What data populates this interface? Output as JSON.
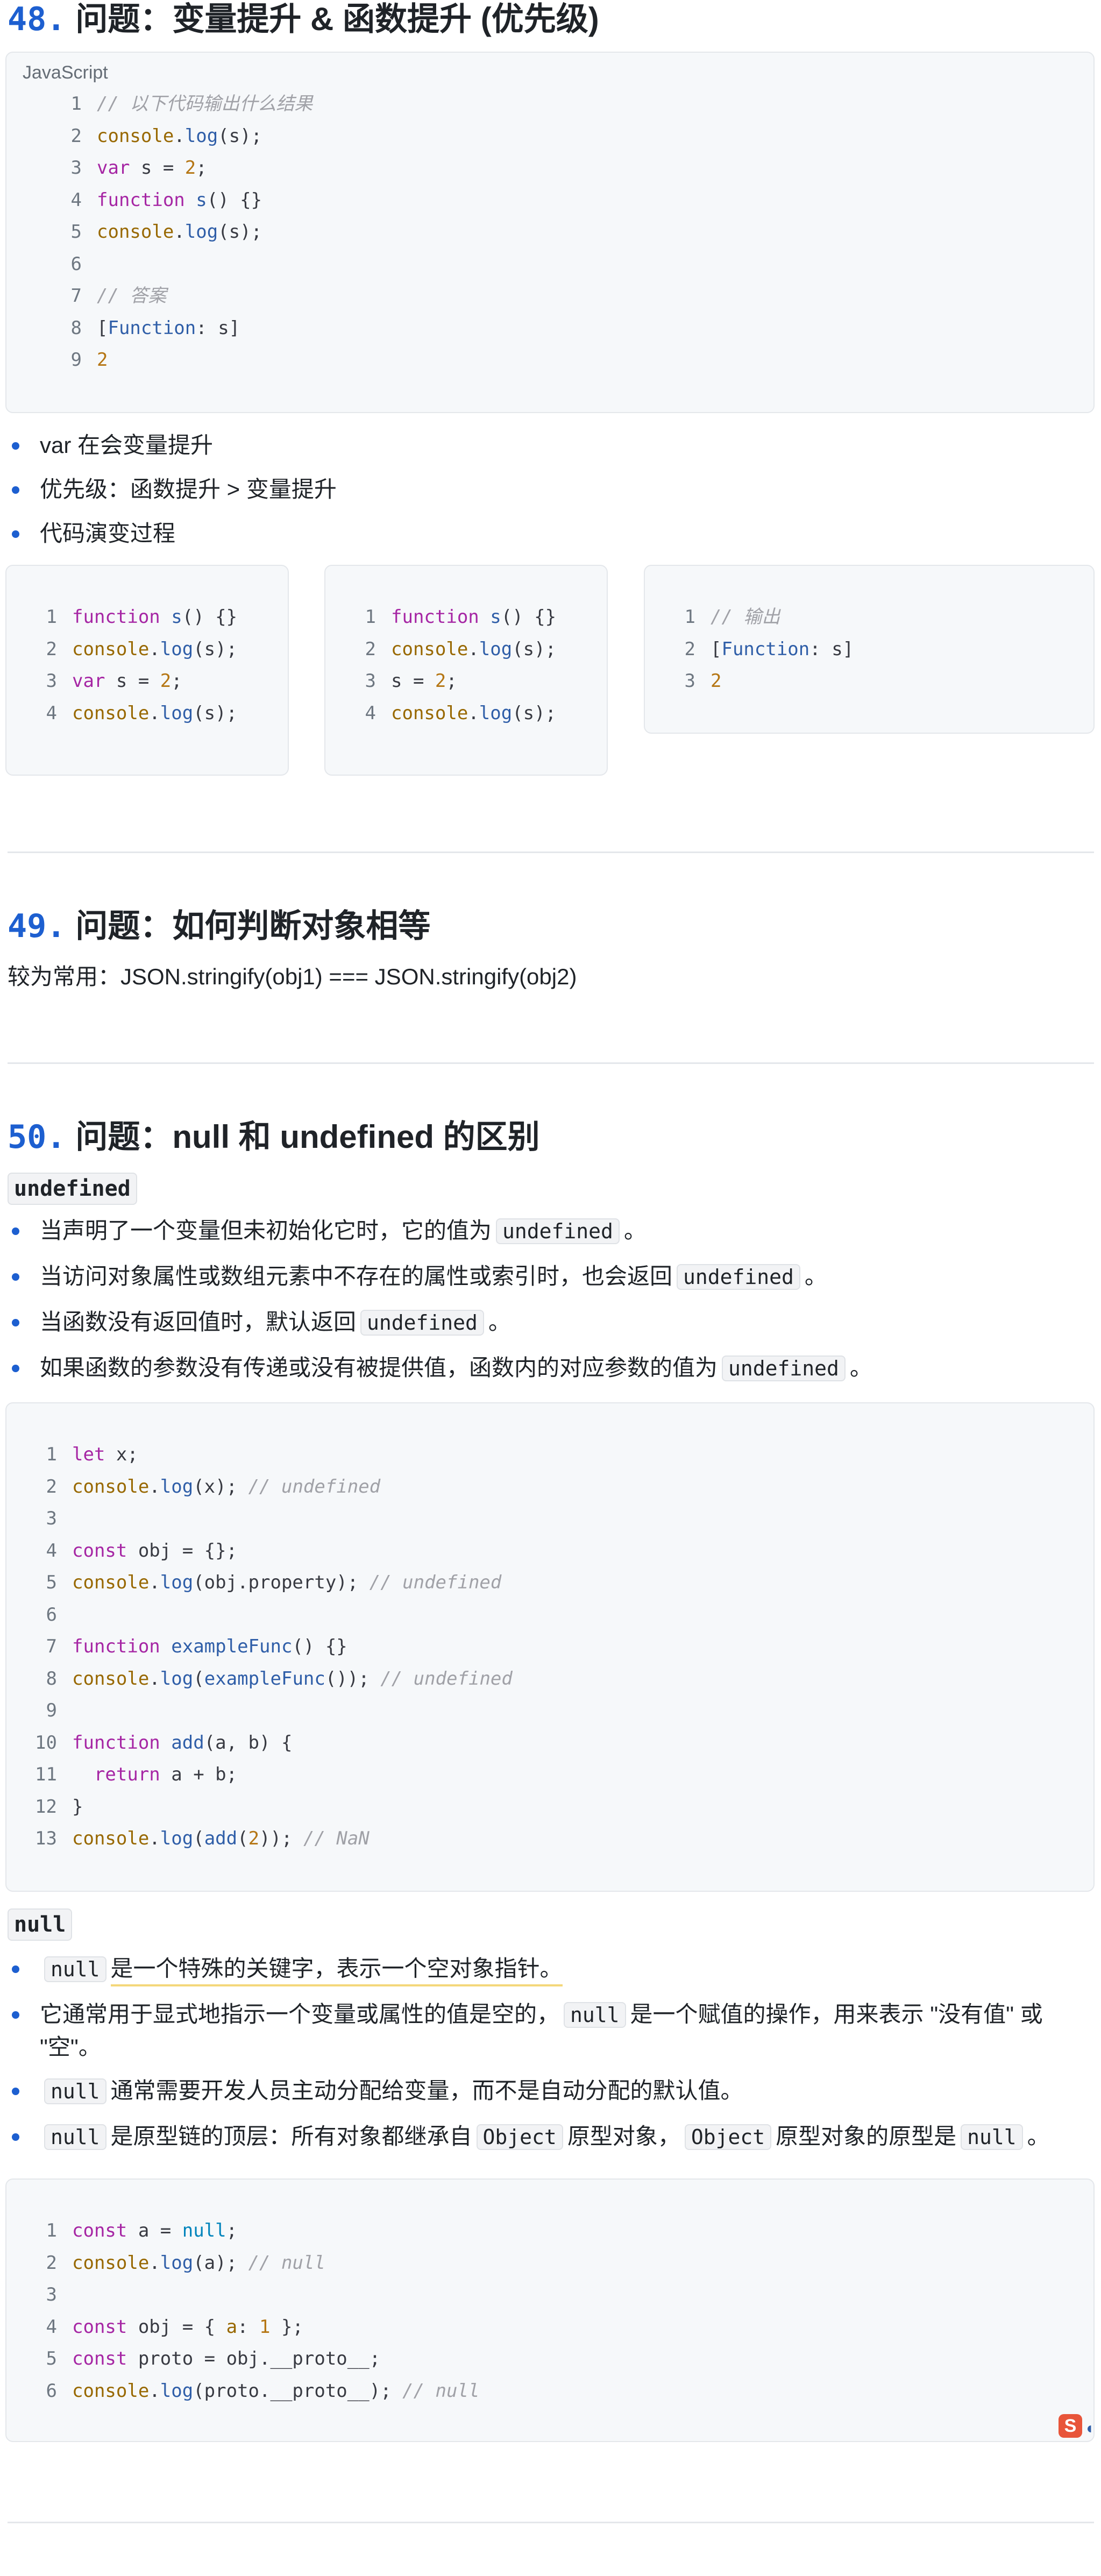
{
  "q48": {
    "num": "48.",
    "title": "问题：变量提升 & 函数提升 (优先级)",
    "lang": "JavaScript",
    "code": [
      {
        "n": "1",
        "parts": [
          {
            "c": "cm",
            "t": "// 以下代码输出什么结果"
          }
        ]
      },
      {
        "n": "2",
        "parts": [
          {
            "c": "obj",
            "t": "console"
          },
          {
            "c": "txt",
            "t": "."
          },
          {
            "c": "fn",
            "t": "log"
          },
          {
            "c": "txt",
            "t": "(s);"
          }
        ]
      },
      {
        "n": "3",
        "parts": [
          {
            "c": "kw",
            "t": "var"
          },
          {
            "c": "txt",
            "t": " s = "
          },
          {
            "c": "numv",
            "t": "2"
          },
          {
            "c": "txt",
            "t": ";"
          }
        ]
      },
      {
        "n": "4",
        "parts": [
          {
            "c": "kw",
            "t": "function"
          },
          {
            "c": "txt",
            "t": " "
          },
          {
            "c": "fn",
            "t": "s"
          },
          {
            "c": "txt",
            "t": "() {}"
          }
        ]
      },
      {
        "n": "5",
        "parts": [
          {
            "c": "obj",
            "t": "console"
          },
          {
            "c": "txt",
            "t": "."
          },
          {
            "c": "fn",
            "t": "log"
          },
          {
            "c": "txt",
            "t": "(s);"
          }
        ]
      },
      {
        "n": "6",
        "parts": []
      },
      {
        "n": "7",
        "parts": [
          {
            "c": "cm",
            "t": "// 答案"
          }
        ]
      },
      {
        "n": "8",
        "parts": [
          {
            "c": "txt",
            "t": "["
          },
          {
            "c": "fn",
            "t": "Function"
          },
          {
            "c": "txt",
            "t": ": s]"
          }
        ]
      },
      {
        "n": "9",
        "parts": [
          {
            "c": "numv",
            "t": "2"
          }
        ]
      }
    ],
    "bullets": [
      "var 在会变量提升",
      "优先级：函数提升 > 变量提升",
      "代码演变过程"
    ],
    "evolution": [
      [
        {
          "n": "1",
          "parts": [
            {
              "c": "kw",
              "t": "function"
            },
            {
              "c": "txt",
              "t": " "
            },
            {
              "c": "fn",
              "t": "s"
            },
            {
              "c": "txt",
              "t": "() {}"
            }
          ]
        },
        {
          "n": "2",
          "parts": [
            {
              "c": "obj",
              "t": "console"
            },
            {
              "c": "txt",
              "t": "."
            },
            {
              "c": "fn",
              "t": "log"
            },
            {
              "c": "txt",
              "t": "(s);"
            }
          ]
        },
        {
          "n": "3",
          "parts": [
            {
              "c": "kw",
              "t": "var"
            },
            {
              "c": "txt",
              "t": " s = "
            },
            {
              "c": "numv",
              "t": "2"
            },
            {
              "c": "txt",
              "t": ";"
            }
          ]
        },
        {
          "n": "4",
          "parts": [
            {
              "c": "obj",
              "t": "console"
            },
            {
              "c": "txt",
              "t": "."
            },
            {
              "c": "fn",
              "t": "log"
            },
            {
              "c": "txt",
              "t": "(s);"
            }
          ]
        }
      ],
      [
        {
          "n": "1",
          "parts": [
            {
              "c": "kw",
              "t": "function"
            },
            {
              "c": "txt",
              "t": " "
            },
            {
              "c": "fn",
              "t": "s"
            },
            {
              "c": "txt",
              "t": "() {}"
            }
          ]
        },
        {
          "n": "2",
          "parts": [
            {
              "c": "obj",
              "t": "console"
            },
            {
              "c": "txt",
              "t": "."
            },
            {
              "c": "fn",
              "t": "log"
            },
            {
              "c": "txt",
              "t": "(s);"
            }
          ]
        },
        {
          "n": "3",
          "parts": [
            {
              "c": "txt",
              "t": "s = "
            },
            {
              "c": "numv",
              "t": "2"
            },
            {
              "c": "txt",
              "t": ";"
            }
          ]
        },
        {
          "n": "4",
          "parts": [
            {
              "c": "obj",
              "t": "console"
            },
            {
              "c": "txt",
              "t": "."
            },
            {
              "c": "fn",
              "t": "log"
            },
            {
              "c": "txt",
              "t": "(s);"
            }
          ]
        }
      ],
      [
        {
          "n": "1",
          "parts": [
            {
              "c": "cm",
              "t": "// 输出"
            }
          ]
        },
        {
          "n": "2",
          "parts": [
            {
              "c": "txt",
              "t": "["
            },
            {
              "c": "fn",
              "t": "Function"
            },
            {
              "c": "txt",
              "t": ": s]"
            }
          ]
        },
        {
          "n": "3",
          "parts": [
            {
              "c": "numv",
              "t": "2"
            }
          ]
        }
      ]
    ]
  },
  "q49": {
    "num": "49.",
    "title": "问题：如何判断对象相等",
    "text": "较为常用：JSON.stringify(obj1) === JSON.stringify(obj2)"
  },
  "q50": {
    "num": "50.",
    "title": "问题：null 和 undefined 的区别",
    "undefined_label": "undefined",
    "undefined_bullets": [
      [
        {
          "t": "当声明了一个变量但未初始化它时，它的值为"
        },
        {
          "code": "undefined"
        },
        {
          "t": "。"
        }
      ],
      [
        {
          "t": "当访问对象属性或数组元素中不存在的属性或索引时，也会返回"
        },
        {
          "code": "undefined"
        },
        {
          "t": "。"
        }
      ],
      [
        {
          "t": "当函数没有返回值时，默认返回"
        },
        {
          "code": "undefined"
        },
        {
          "t": "。"
        }
      ],
      [
        {
          "t": "如果函数的参数没有传递或没有被提供值，函数内的对应参数的值为"
        },
        {
          "code": "undefined"
        },
        {
          "t": "。"
        }
      ]
    ],
    "undefined_code": [
      {
        "n": "1",
        "parts": [
          {
            "c": "kw",
            "t": "let"
          },
          {
            "c": "txt",
            "t": " x;"
          }
        ]
      },
      {
        "n": "2",
        "parts": [
          {
            "c": "obj",
            "t": "console"
          },
          {
            "c": "txt",
            "t": "."
          },
          {
            "c": "fn",
            "t": "log"
          },
          {
            "c": "txt",
            "t": "(x); "
          },
          {
            "c": "cm",
            "t": "// undefined"
          }
        ]
      },
      {
        "n": "3",
        "parts": []
      },
      {
        "n": "4",
        "parts": [
          {
            "c": "kw",
            "t": "const"
          },
          {
            "c": "txt",
            "t": " obj = {};"
          }
        ]
      },
      {
        "n": "5",
        "parts": [
          {
            "c": "obj",
            "t": "console"
          },
          {
            "c": "txt",
            "t": "."
          },
          {
            "c": "fn",
            "t": "log"
          },
          {
            "c": "txt",
            "t": "(obj.property); "
          },
          {
            "c": "cm",
            "t": "// undefined"
          }
        ]
      },
      {
        "n": "6",
        "parts": []
      },
      {
        "n": "7",
        "parts": [
          {
            "c": "kw",
            "t": "function"
          },
          {
            "c": "txt",
            "t": " "
          },
          {
            "c": "fn",
            "t": "exampleFunc"
          },
          {
            "c": "txt",
            "t": "() {}"
          }
        ]
      },
      {
        "n": "8",
        "parts": [
          {
            "c": "obj",
            "t": "console"
          },
          {
            "c": "txt",
            "t": "."
          },
          {
            "c": "fn",
            "t": "log"
          },
          {
            "c": "txt",
            "t": "("
          },
          {
            "c": "fn",
            "t": "exampleFunc"
          },
          {
            "c": "txt",
            "t": "()); "
          },
          {
            "c": "cm",
            "t": "// undefined"
          }
        ]
      },
      {
        "n": "9",
        "parts": []
      },
      {
        "n": "10",
        "parts": [
          {
            "c": "kw",
            "t": "function"
          },
          {
            "c": "txt",
            "t": " "
          },
          {
            "c": "fn",
            "t": "add"
          },
          {
            "c": "txt",
            "t": "(a, b) {"
          }
        ]
      },
      {
        "n": "11",
        "parts": [
          {
            "c": "txt",
            "t": "  "
          },
          {
            "c": "kw",
            "t": "return"
          },
          {
            "c": "txt",
            "t": " a + b;"
          }
        ]
      },
      {
        "n": "12",
        "parts": [
          {
            "c": "txt",
            "t": "}"
          }
        ]
      },
      {
        "n": "13",
        "parts": [
          {
            "c": "obj",
            "t": "console"
          },
          {
            "c": "txt",
            "t": "."
          },
          {
            "c": "fn",
            "t": "log"
          },
          {
            "c": "txt",
            "t": "("
          },
          {
            "c": "fn",
            "t": "add"
          },
          {
            "c": "txt",
            "t": "("
          },
          {
            "c": "numv",
            "t": "2"
          },
          {
            "c": "txt",
            "t": ")); "
          },
          {
            "c": "cm",
            "t": "// NaN"
          }
        ]
      }
    ],
    "null_label": "null",
    "null_bullets": [
      [
        {
          "code": "null"
        },
        {
          "t": "是一个特殊的关键字，表示一个空对象指针。",
          "hl": true
        }
      ],
      [
        {
          "t": "它通常用于显式地指示一个变量或属性的值是空的，"
        },
        {
          "code": "null"
        },
        {
          "t": "是一个赋值的操作，用来表示 \"没有值\" 或"
        }
      ],
      [
        {
          "code": "null"
        },
        {
          "t": "通常需要开发人员主动分配给变量，而不是自动分配的默认值。"
        }
      ],
      [
        {
          "code": "null"
        },
        {
          "t": "是原型链的顶层：所有对象都继承自"
        },
        {
          "code": "Object"
        },
        {
          "t": "原型对象，"
        },
        {
          "code": "Object"
        },
        {
          "t": "原型对象的原型是"
        },
        {
          "code": "null"
        },
        {
          "t": "。"
        }
      ]
    ],
    "null_bullet2_cont": "\"空\"。",
    "null_code": [
      {
        "n": "1",
        "parts": [
          {
            "c": "kw",
            "t": "const"
          },
          {
            "c": "txt",
            "t": " a = "
          },
          {
            "c": "nul",
            "t": "null"
          },
          {
            "c": "txt",
            "t": ";"
          }
        ]
      },
      {
        "n": "2",
        "parts": [
          {
            "c": "obj",
            "t": "console"
          },
          {
            "c": "txt",
            "t": "."
          },
          {
            "c": "fn",
            "t": "log"
          },
          {
            "c": "txt",
            "t": "(a); "
          },
          {
            "c": "cm",
            "t": "// null"
          }
        ]
      },
      {
        "n": "3",
        "parts": []
      },
      {
        "n": "4",
        "parts": [
          {
            "c": "kw",
            "t": "const"
          },
          {
            "c": "txt",
            "t": " obj = { "
          },
          {
            "c": "obj",
            "t": "a"
          },
          {
            "c": "txt",
            "t": ": "
          },
          {
            "c": "numv",
            "t": "1"
          },
          {
            "c": "txt",
            "t": " };"
          }
        ]
      },
      {
        "n": "5",
        "parts": [
          {
            "c": "kw",
            "t": "const"
          },
          {
            "c": "txt",
            "t": " proto = obj.__proto__;"
          }
        ]
      },
      {
        "n": "6",
        "parts": [
          {
            "c": "obj",
            "t": "console"
          },
          {
            "c": "txt",
            "t": "."
          },
          {
            "c": "fn",
            "t": "log"
          },
          {
            "c": "txt",
            "t": "(proto.__proto__); "
          },
          {
            "c": "cm",
            "t": "// null"
          }
        ]
      }
    ],
    "badge_icon": "s-logo-icon"
  }
}
